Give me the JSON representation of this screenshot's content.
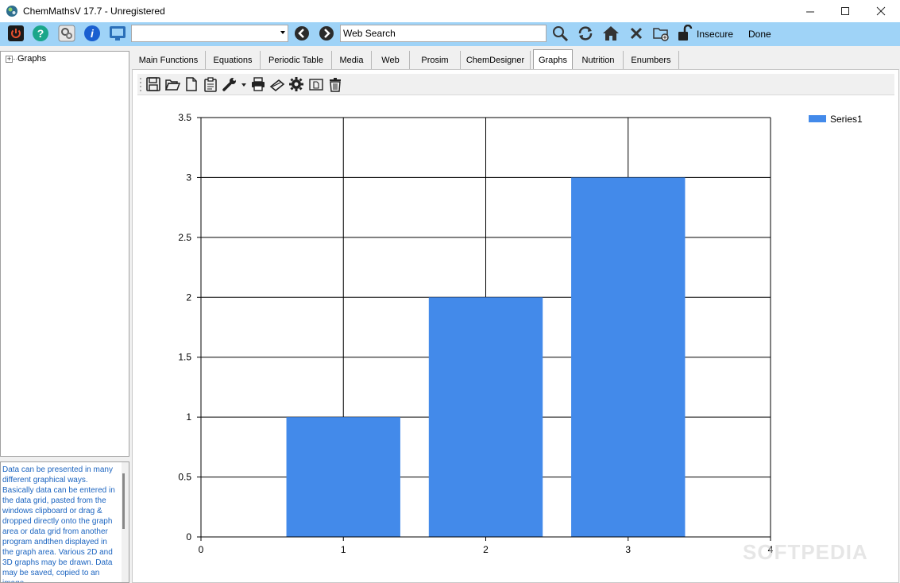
{
  "window": {
    "title": "ChemMathsV 17.7 - Unregistered",
    "controls": [
      "minimize",
      "maximize",
      "close"
    ]
  },
  "toolbar": {
    "buttons": [
      "power-icon",
      "help-icon",
      "settings-icon",
      "info-icon",
      "screen-icon"
    ],
    "combo_value": "",
    "search_value": "Web Search",
    "browser_buttons": [
      "back-icon",
      "forward-icon",
      "search-icon",
      "refresh-icon",
      "home-icon",
      "stop-icon",
      "add-folder-icon",
      "lock-icon"
    ],
    "security_label": "Insecure",
    "status_label": "Done"
  },
  "tree": {
    "root_label": "Graphs"
  },
  "help": {
    "text": "Data can be presented in many different graphical ways. Basically data can be entered in the data grid, pasted from the windows clipboard or drag & dropped directly onto the graph area or data grid from another program andthen displayed in the graph area. Various 2D and 3D graphs may be drawn. Data may be saved, copied to an image"
  },
  "tabs": [
    {
      "label": "Main Functions",
      "active": false
    },
    {
      "label": "Equations",
      "active": false
    },
    {
      "label": "Periodic Table",
      "active": false
    },
    {
      "label": "Media",
      "active": false
    },
    {
      "label": "Web",
      "active": false
    },
    {
      "label": "Prosim",
      "active": false
    },
    {
      "label": "ChemDesigner",
      "active": false
    },
    {
      "label": "Graphs",
      "active": true
    },
    {
      "label": "Nutrition",
      "active": false
    },
    {
      "label": "Enumbers",
      "active": false
    }
  ],
  "graph_toolbar": {
    "icons": [
      "save-icon",
      "open-icon",
      "new-icon",
      "clipboard-icon",
      "wrench-icon",
      "print-icon",
      "scan-icon",
      "gear-icon",
      "new-page-icon",
      "trash-icon"
    ]
  },
  "watermark": "SOFTPEDIA",
  "colors": {
    "toolbar_bg": "#9fd3f7",
    "bar_fill": "#438aea",
    "help_text": "#1b64c0"
  },
  "chart_data": {
    "type": "bar",
    "x": [
      1,
      2,
      3
    ],
    "series": [
      {
        "name": "Series1",
        "values": [
          1,
          2,
          3
        ]
      }
    ],
    "xlim": [
      0,
      4
    ],
    "ylim": [
      0,
      3.5
    ],
    "xticks": [
      "0",
      "1",
      "2",
      "3",
      "4"
    ],
    "yticks": [
      "0",
      "0.5",
      "1",
      "1.5",
      "2",
      "2.5",
      "3",
      "3.5"
    ],
    "grid": true,
    "legend": "top-right",
    "title": "",
    "xlabel": "",
    "ylabel": ""
  }
}
